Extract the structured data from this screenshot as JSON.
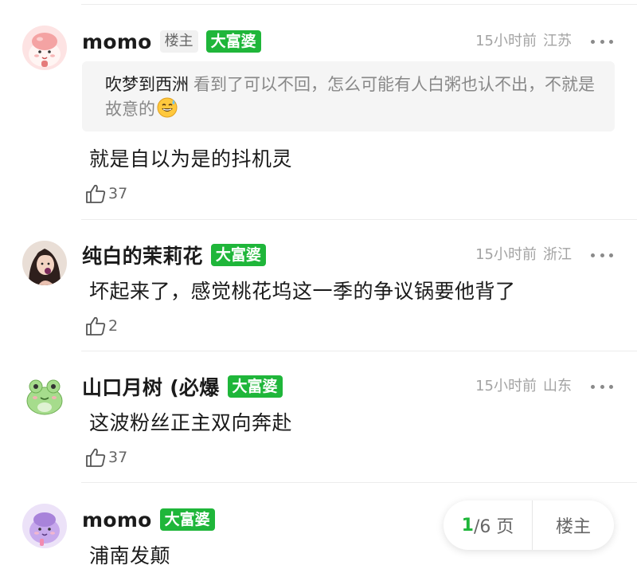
{
  "comments": [
    {
      "name": "momo",
      "owner_tag": "楼主",
      "badge": "大富婆",
      "time": "15小时前",
      "location": "江苏",
      "quote": {
        "name": "吹梦到西洲",
        "text": "看到了可以不回，怎么可能有人白粥也认不出，不就是故意的"
      },
      "text": "就是自以为是的抖机灵",
      "likes": "37"
    },
    {
      "name": "纯白的茉莉花",
      "badge": "大富婆",
      "time": "15小时前",
      "location": "浙江",
      "text": "坏起来了，感觉桃花坞这一季的争议锅要他背了",
      "likes": "2"
    },
    {
      "name": "山口月树 (必爆",
      "badge": "大富婆",
      "time": "15小时前",
      "location": "山东",
      "text": "这波粉丝正主双向奔赴",
      "likes": "37"
    },
    {
      "name": "momo",
      "badge": "大富婆",
      "text": "浦南发颠"
    }
  ],
  "pager": {
    "current": "1",
    "total_text": "/6 页",
    "owner_label": "楼主"
  },
  "colors": {
    "badge_green": "#1fb63a",
    "meta_gray": "#a3a3a3"
  }
}
